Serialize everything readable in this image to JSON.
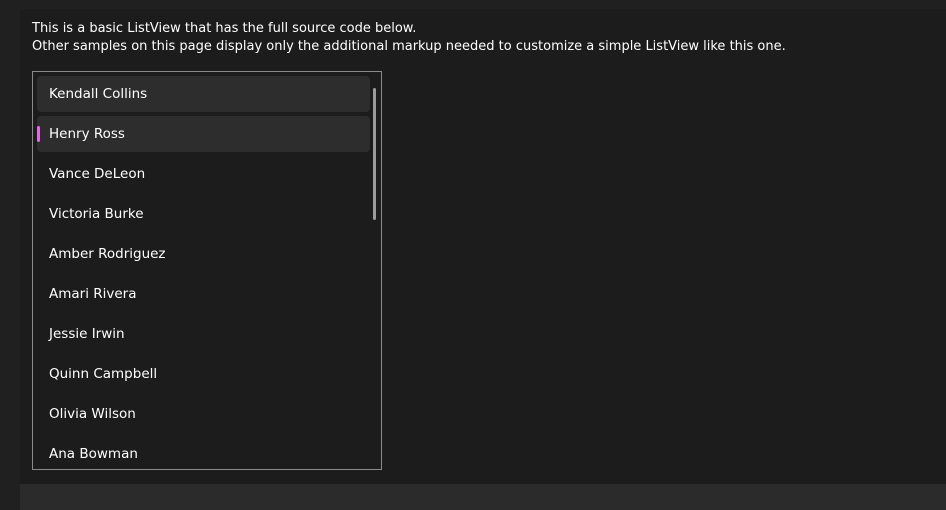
{
  "description": {
    "line1": "This is a basic ListView that has the full source code below.",
    "line2": "Other samples on this page display only the additional markup needed to customize a simple ListView like this one."
  },
  "listview": {
    "items": [
      {
        "label": "Kendall Collins",
        "state": "hover"
      },
      {
        "label": "Henry Ross",
        "state": "selected"
      },
      {
        "label": "Vance DeLeon",
        "state": "normal"
      },
      {
        "label": "Victoria Burke",
        "state": "normal"
      },
      {
        "label": "Amber Rodriguez",
        "state": "normal"
      },
      {
        "label": "Amari Rivera",
        "state": "normal"
      },
      {
        "label": "Jessie Irwin",
        "state": "normal"
      },
      {
        "label": "Quinn Campbell",
        "state": "normal"
      },
      {
        "label": "Olivia Wilson",
        "state": "normal"
      },
      {
        "label": "Ana Bowman",
        "state": "normal"
      }
    ],
    "selected_index": 1
  },
  "colors": {
    "accent": "#e366e9",
    "item_hover": "#2d2d2d",
    "item_selected": "#2d2d2d",
    "border": "#8a8a8a"
  }
}
